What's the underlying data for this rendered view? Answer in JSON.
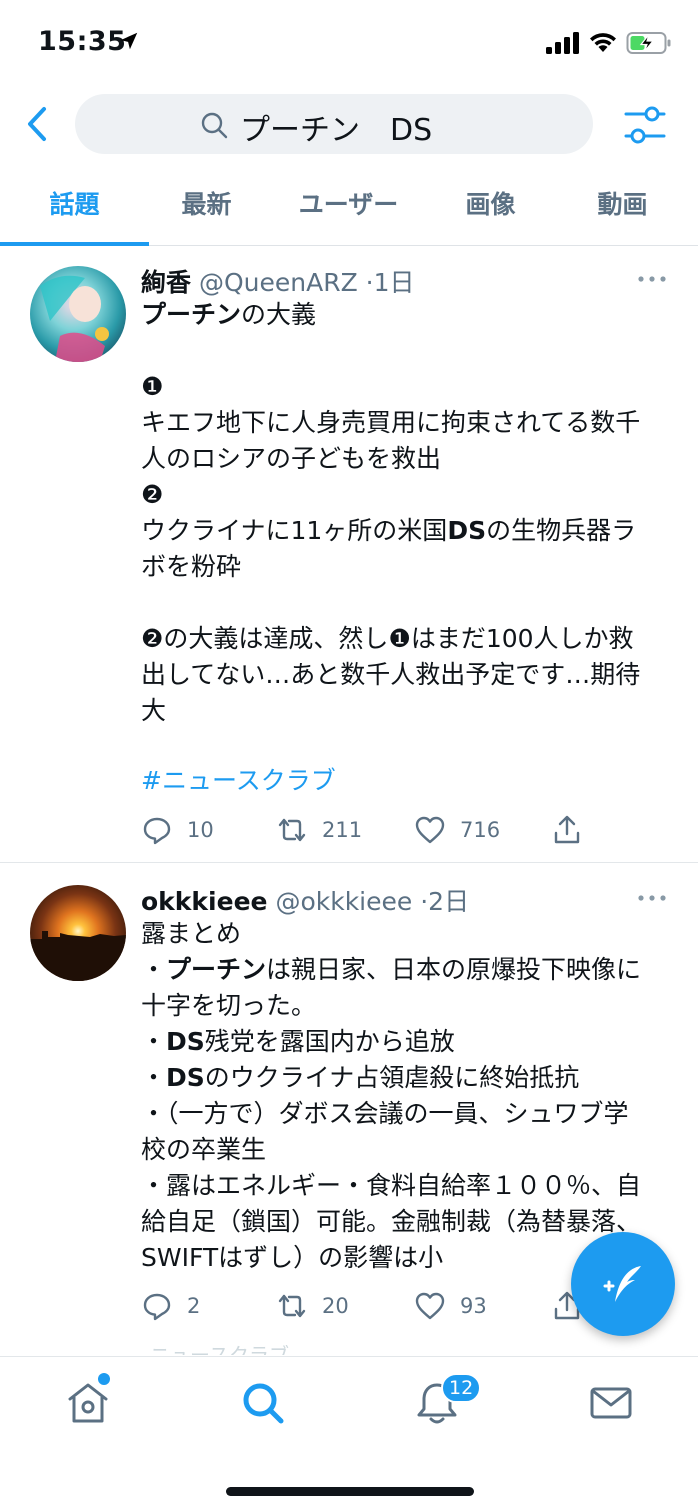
{
  "status_bar": {
    "time": "15:35"
  },
  "search": {
    "query": "プーチン　DS"
  },
  "tabs": [
    {
      "label": "話題",
      "active": true
    },
    {
      "label": "最新",
      "active": false
    },
    {
      "label": "ユーザー",
      "active": false
    },
    {
      "label": "画像",
      "active": false
    },
    {
      "label": "動画",
      "active": false
    }
  ],
  "tweets": [
    {
      "name": "絢香",
      "handle": "@QueenARZ",
      "time": "·1日",
      "lines": [
        [
          "",
          "プーチン",
          "の大義"
        ],
        "",
        "❶",
        "キエフ地下に人身売買用に拘束されてる数千",
        "人のロシアの子どもを救出",
        "❷",
        [
          "ウクライナに11ヶ所の米国",
          "DS",
          "の生物兵器ラ"
        ],
        "ボを粉砕",
        "",
        "❷の大義は達成、然し❶はまだ100人しか救",
        "出してない…あと数千人救出予定です…期待",
        "大",
        ""
      ],
      "hashtag": "#ニュースクラブ",
      "replies": "10",
      "retweets": "211",
      "likes": "716"
    },
    {
      "name": "okkkieee",
      "handle": "@okkkieee",
      "time": "·2日",
      "lines": [
        "露まとめ",
        [
          "・",
          "プーチン",
          "は親日家、日本の原爆投下映像に"
        ],
        "十字を切った。",
        [
          "・",
          "DS",
          "残党を露国内から追放"
        ],
        [
          "・",
          "DS",
          "のウクライナ占領虐殺に終始抵抗"
        ],
        "・（一方で）ダボス会議の一員、シュワブ学",
        "校の卒業生",
        "・露はエネルギー・食料自給率１００％、自",
        "給自足（鎖国）可能。金融制裁（為替暴落、",
        "SWIFTはずし）の影響は小"
      ],
      "replies": "2",
      "retweets": "20",
      "likes": "93"
    }
  ],
  "bottom_nav": {
    "notifications_badge": "12",
    "peek_text": "ニュースクラブ"
  },
  "colors": {
    "accent": "#1d9bf0",
    "secondary_text": "#5b7083",
    "primary_text": "#0f1419",
    "search_bg": "#eef1f4",
    "battery_green": "#4cd964"
  }
}
